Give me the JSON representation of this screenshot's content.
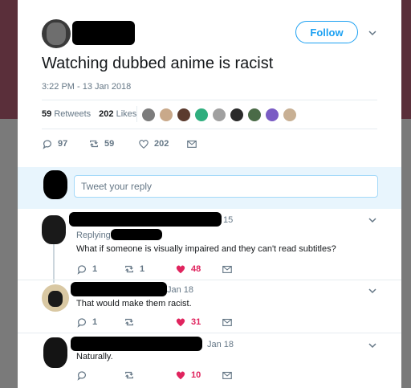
{
  "tweet": {
    "text": "Watching dubbed anime is racist",
    "timestamp": "3:22 PM - 13 Jan 2018",
    "follow_label": "Follow",
    "retweets_count": "59",
    "retweets_label": "Retweets",
    "likes_count": "202",
    "likes_label": "Likes",
    "actions": {
      "replies": "97",
      "retweets": "59",
      "likes": "202"
    }
  },
  "reply_box": {
    "placeholder": "Tweet your reply"
  },
  "replies": [
    {
      "date_fragment": "15",
      "replying_label": "Replying",
      "text": "What if someone is visually impaired and they can't read subtitles?",
      "replies": "1",
      "retweets": "1",
      "likes": "48"
    },
    {
      "date_fragment": "Jan 18",
      "text": "That would make them racist.",
      "replies": "1",
      "retweets": "",
      "likes": "31"
    },
    {
      "date_fragment": "Jan 18",
      "text": "Naturally.",
      "replies": "",
      "retweets": "",
      "likes": "10"
    }
  ],
  "colors": {
    "accent": "#1da1f2",
    "like": "#e0245e",
    "muted": "#657786"
  }
}
